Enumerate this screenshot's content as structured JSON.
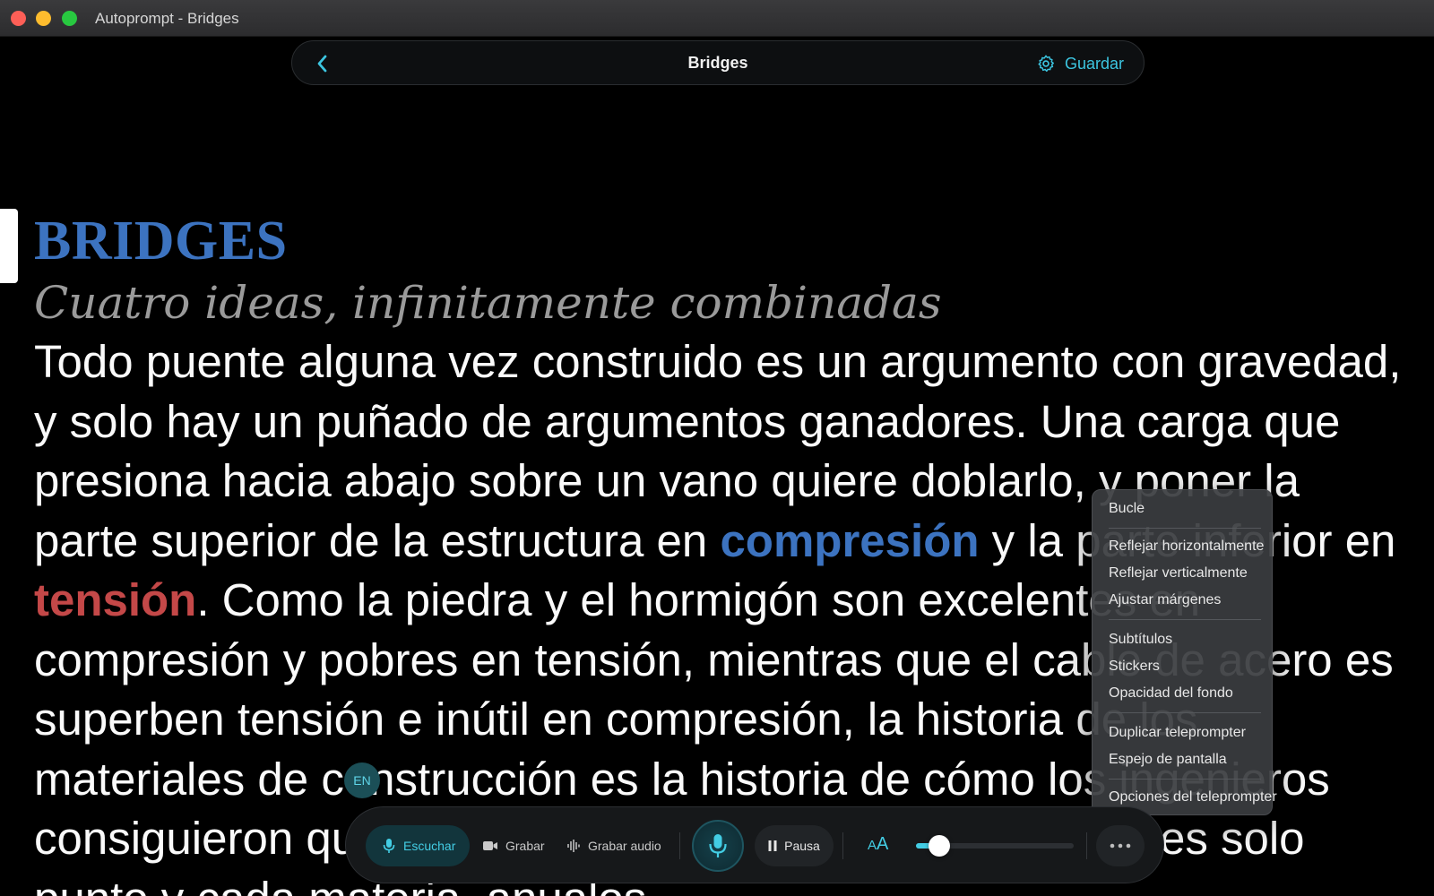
{
  "window": {
    "title": "Autoprompt - Bridges"
  },
  "topnav": {
    "doc_title": "Bridges",
    "save_label": "Guardar"
  },
  "script": {
    "heading": "BRIDGES",
    "subheading": "Cuatro ideas, infinitamente combinadas",
    "body": {
      "s1": "Todo puente alguna vez construido es un argumento con gravedad, y solo hay un puñado de argumentos ganadores. Una carga que presiona hacia abajo sobre un vano quiere doblarlo, y poner la parte superior de la estructura en ",
      "hl1": "compresión",
      "s2": " y la parte inferior en ",
      "hl2": "tensión",
      "s3": ". Como la piedra y el hormigón son excelentes en compresión y pobres en tensión, mientras que el cable de acero es superben tensión e inútil en compresión, la historia de los materiales de construcción es la historia de cómo los ingenieros consiguieron que solo haya historia en qué muchas veces solo punto y cada materia, anualos"
    }
  },
  "lang_badge": "EN",
  "menu": {
    "items": [
      "Bucle",
      "Reflejar horizontalmente",
      "Reflejar verticalmente",
      "Ajustar márgenes",
      "Subtítulos",
      "Stickers",
      "Opacidad del fondo",
      "Duplicar teleprompter",
      "Espejo de pantalla",
      "Opciones del teleprompter"
    ]
  },
  "controls": {
    "listen_label": "Escuchar",
    "record_label": "Grabar",
    "record_audio_label": "Grabar audio",
    "pause_label": "Pausa",
    "font_size_label_small": "A",
    "font_size_label_large": "A",
    "speed_level": 0.15
  },
  "colors": {
    "accent": "#43cde4",
    "heading_blue": "#3c73c0",
    "tension_red": "#c44848"
  }
}
